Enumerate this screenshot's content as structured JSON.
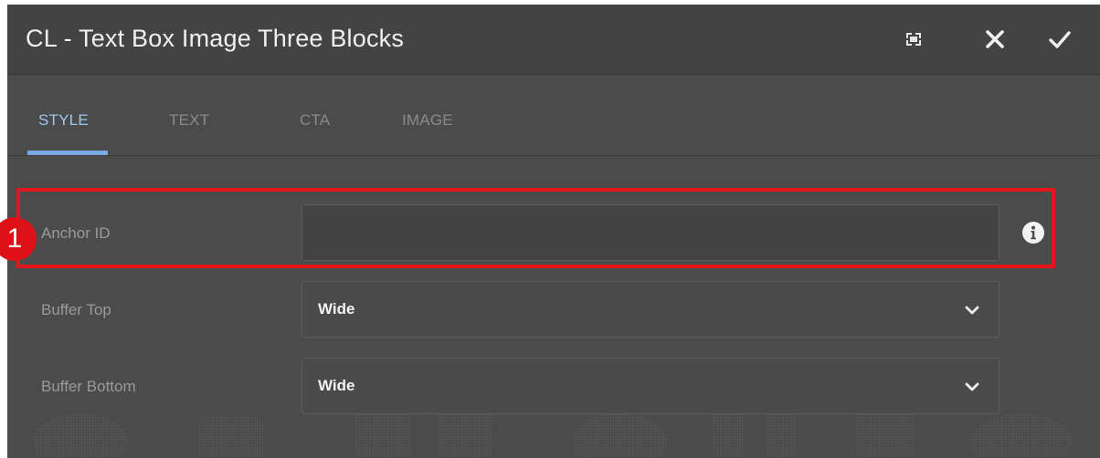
{
  "dialog": {
    "title": "CL - Text Box Image Three Blocks",
    "actions": {
      "fullscreen_icon": "fullscreen-icon",
      "close_icon": "close-icon",
      "done_icon": "checkmark-icon"
    }
  },
  "tabs": [
    {
      "label": "STYLE",
      "active": true
    },
    {
      "label": "TEXT",
      "active": false
    },
    {
      "label": "CTA",
      "active": false
    },
    {
      "label": "IMAGE",
      "active": false
    }
  ],
  "fields": {
    "anchor_id": {
      "label": "Anchor ID",
      "value": "",
      "info_icon": "info-icon"
    },
    "buffer_top": {
      "label": "Buffer Top",
      "selected": "Wide"
    },
    "buffer_bottom": {
      "label": "Buffer Bottom",
      "selected": "Wide"
    }
  },
  "annotation": {
    "number": "1"
  },
  "colors": {
    "dialog_bg": "#4b4b4b",
    "header_bg": "#434343",
    "active_tab": "#9ec6ef",
    "tab_underline": "#7aa9e8",
    "highlight": "#e8141b"
  }
}
